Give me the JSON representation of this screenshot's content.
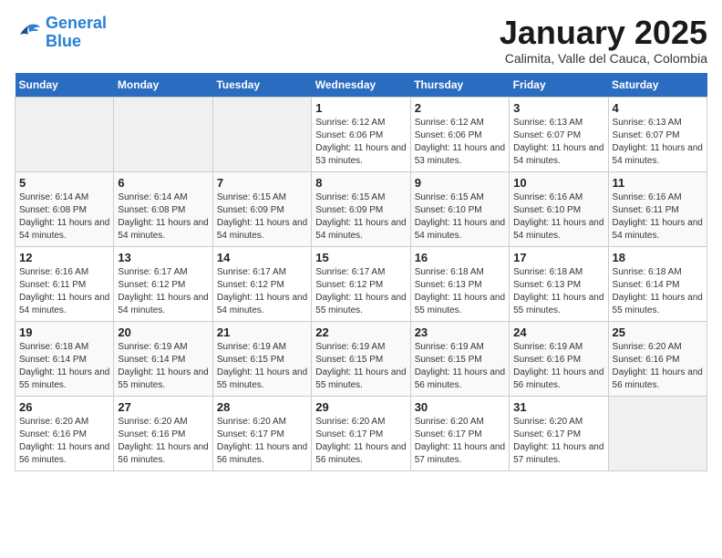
{
  "header": {
    "logo_line1": "General",
    "logo_line2": "Blue",
    "month": "January 2025",
    "location": "Calimita, Valle del Cauca, Colombia"
  },
  "weekdays": [
    "Sunday",
    "Monday",
    "Tuesday",
    "Wednesday",
    "Thursday",
    "Friday",
    "Saturday"
  ],
  "weeks": [
    [
      {
        "day": "",
        "info": ""
      },
      {
        "day": "",
        "info": ""
      },
      {
        "day": "",
        "info": ""
      },
      {
        "day": "1",
        "info": "Sunrise: 6:12 AM\nSunset: 6:06 PM\nDaylight: 11 hours and 53 minutes."
      },
      {
        "day": "2",
        "info": "Sunrise: 6:12 AM\nSunset: 6:06 PM\nDaylight: 11 hours and 53 minutes."
      },
      {
        "day": "3",
        "info": "Sunrise: 6:13 AM\nSunset: 6:07 PM\nDaylight: 11 hours and 54 minutes."
      },
      {
        "day": "4",
        "info": "Sunrise: 6:13 AM\nSunset: 6:07 PM\nDaylight: 11 hours and 54 minutes."
      }
    ],
    [
      {
        "day": "5",
        "info": "Sunrise: 6:14 AM\nSunset: 6:08 PM\nDaylight: 11 hours and 54 minutes."
      },
      {
        "day": "6",
        "info": "Sunrise: 6:14 AM\nSunset: 6:08 PM\nDaylight: 11 hours and 54 minutes."
      },
      {
        "day": "7",
        "info": "Sunrise: 6:15 AM\nSunset: 6:09 PM\nDaylight: 11 hours and 54 minutes."
      },
      {
        "day": "8",
        "info": "Sunrise: 6:15 AM\nSunset: 6:09 PM\nDaylight: 11 hours and 54 minutes."
      },
      {
        "day": "9",
        "info": "Sunrise: 6:15 AM\nSunset: 6:10 PM\nDaylight: 11 hours and 54 minutes."
      },
      {
        "day": "10",
        "info": "Sunrise: 6:16 AM\nSunset: 6:10 PM\nDaylight: 11 hours and 54 minutes."
      },
      {
        "day": "11",
        "info": "Sunrise: 6:16 AM\nSunset: 6:11 PM\nDaylight: 11 hours and 54 minutes."
      }
    ],
    [
      {
        "day": "12",
        "info": "Sunrise: 6:16 AM\nSunset: 6:11 PM\nDaylight: 11 hours and 54 minutes."
      },
      {
        "day": "13",
        "info": "Sunrise: 6:17 AM\nSunset: 6:12 PM\nDaylight: 11 hours and 54 minutes."
      },
      {
        "day": "14",
        "info": "Sunrise: 6:17 AM\nSunset: 6:12 PM\nDaylight: 11 hours and 54 minutes."
      },
      {
        "day": "15",
        "info": "Sunrise: 6:17 AM\nSunset: 6:12 PM\nDaylight: 11 hours and 55 minutes."
      },
      {
        "day": "16",
        "info": "Sunrise: 6:18 AM\nSunset: 6:13 PM\nDaylight: 11 hours and 55 minutes."
      },
      {
        "day": "17",
        "info": "Sunrise: 6:18 AM\nSunset: 6:13 PM\nDaylight: 11 hours and 55 minutes."
      },
      {
        "day": "18",
        "info": "Sunrise: 6:18 AM\nSunset: 6:14 PM\nDaylight: 11 hours and 55 minutes."
      }
    ],
    [
      {
        "day": "19",
        "info": "Sunrise: 6:18 AM\nSunset: 6:14 PM\nDaylight: 11 hours and 55 minutes."
      },
      {
        "day": "20",
        "info": "Sunrise: 6:19 AM\nSunset: 6:14 PM\nDaylight: 11 hours and 55 minutes."
      },
      {
        "day": "21",
        "info": "Sunrise: 6:19 AM\nSunset: 6:15 PM\nDaylight: 11 hours and 55 minutes."
      },
      {
        "day": "22",
        "info": "Sunrise: 6:19 AM\nSunset: 6:15 PM\nDaylight: 11 hours and 55 minutes."
      },
      {
        "day": "23",
        "info": "Sunrise: 6:19 AM\nSunset: 6:15 PM\nDaylight: 11 hours and 56 minutes."
      },
      {
        "day": "24",
        "info": "Sunrise: 6:19 AM\nSunset: 6:16 PM\nDaylight: 11 hours and 56 minutes."
      },
      {
        "day": "25",
        "info": "Sunrise: 6:20 AM\nSunset: 6:16 PM\nDaylight: 11 hours and 56 minutes."
      }
    ],
    [
      {
        "day": "26",
        "info": "Sunrise: 6:20 AM\nSunset: 6:16 PM\nDaylight: 11 hours and 56 minutes."
      },
      {
        "day": "27",
        "info": "Sunrise: 6:20 AM\nSunset: 6:16 PM\nDaylight: 11 hours and 56 minutes."
      },
      {
        "day": "28",
        "info": "Sunrise: 6:20 AM\nSunset: 6:17 PM\nDaylight: 11 hours and 56 minutes."
      },
      {
        "day": "29",
        "info": "Sunrise: 6:20 AM\nSunset: 6:17 PM\nDaylight: 11 hours and 56 minutes."
      },
      {
        "day": "30",
        "info": "Sunrise: 6:20 AM\nSunset: 6:17 PM\nDaylight: 11 hours and 57 minutes."
      },
      {
        "day": "31",
        "info": "Sunrise: 6:20 AM\nSunset: 6:17 PM\nDaylight: 11 hours and 57 minutes."
      },
      {
        "day": "",
        "info": ""
      }
    ]
  ]
}
